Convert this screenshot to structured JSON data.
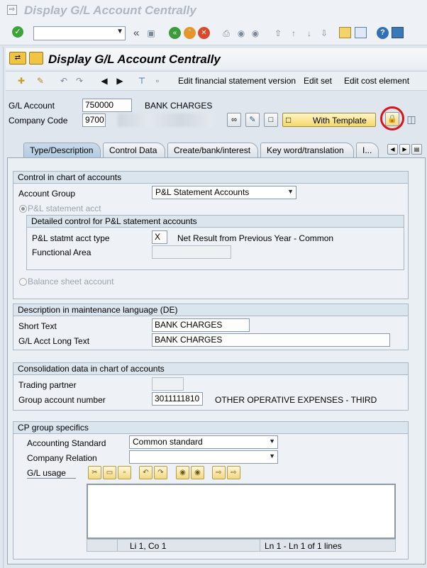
{
  "window_title": "Display G/L Account Centrally",
  "app_title": "Display G/L Account Centrally",
  "command_field": {
    "value": ""
  },
  "app_toolbar": {
    "edit_fs_version": "Edit financial statement version",
    "edit_set": "Edit set",
    "edit_cost_element": "Edit cost element"
  },
  "header": {
    "gl_account_label": "G/L Account",
    "gl_account_value": "750000",
    "gl_account_text": "BANK CHARGES",
    "company_code_label": "Company Code",
    "company_code_value": "9700",
    "with_template_label": "With Template"
  },
  "tabs": [
    {
      "label": "Type/Description"
    },
    {
      "label": "Control Data"
    },
    {
      "label": "Create/bank/interest"
    },
    {
      "label": "Key word/translation"
    },
    {
      "label": "I..."
    }
  ],
  "control_group": {
    "title": "Control in chart of accounts",
    "account_group_label": "Account Group",
    "account_group_value": "P&L Statement Accounts",
    "pl_radio_label": "P&L statement acct",
    "detail_title": "Detailed control for P&L statement accounts",
    "pl_type_label": "P&L statmt acct type",
    "pl_type_value": "X",
    "pl_type_text": "Net Result from Previous Year - Common",
    "functional_area_label": "Functional Area",
    "functional_area_value": "",
    "balance_radio_label": "Balance sheet account"
  },
  "description_group": {
    "title": "Description in maintenance language (DE)",
    "short_text_label": "Short Text",
    "short_text_value": "BANK CHARGES",
    "long_text_label": "G/L Acct Long Text",
    "long_text_value": "BANK CHARGES"
  },
  "consolidation_group": {
    "title": "Consolidation data in chart of accounts",
    "trading_partner_label": "Trading partner",
    "trading_partner_value": "",
    "group_account_label": "Group account number",
    "group_account_value": "3011111810",
    "group_account_text": "OTHER OPERATIVE EXPENSES - THIRD"
  },
  "cp_group": {
    "title": "CP group specifics",
    "accounting_standard_label": "Accounting Standard",
    "accounting_standard_value": "Common standard",
    "company_relation_label": "Company Relation",
    "company_relation_value": "",
    "gl_usage_label": "G/L usage",
    "status_pos": "Li 1, Co 1",
    "status_lines": "Ln 1 - Ln 1 of 1 lines"
  }
}
